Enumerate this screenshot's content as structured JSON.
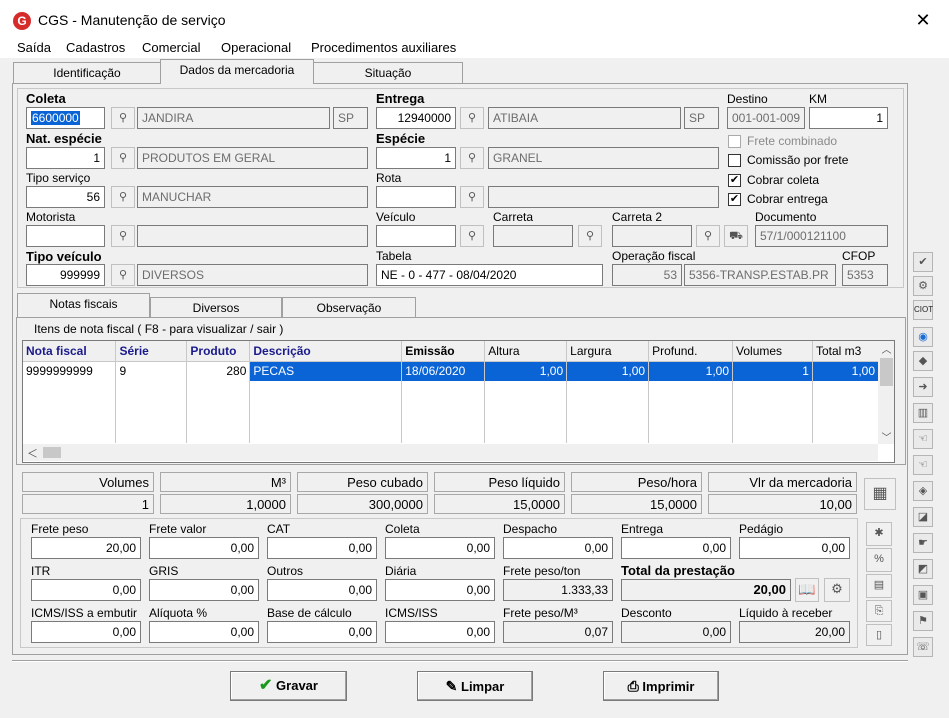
{
  "window": {
    "title": "CGS - Manutenção de serviço",
    "logo_letter": "G",
    "close_glyph": "✕"
  },
  "menu": [
    "Saída",
    "Cadastros",
    "Comercial",
    "Operacional",
    "Procedimentos auxiliares"
  ],
  "top_tabs": [
    "Identificação",
    "Dados da mercadoria",
    "Situação"
  ],
  "header": {
    "coleta": {
      "label": "Coleta",
      "code": "6600000",
      "city": "JANDIRA",
      "uf": "SP"
    },
    "entrega": {
      "label": "Entrega",
      "code": "12940000",
      "city": "ATIBAIA",
      "uf": "SP"
    },
    "destino": {
      "label": "Destino",
      "value": "001-001-009"
    },
    "km": {
      "label": "KM",
      "value": "1"
    },
    "nat_especie": {
      "label": "Nat. espécie",
      "code": "1",
      "desc": "PRODUTOS EM GERAL"
    },
    "especie": {
      "label": "Espécie",
      "code": "1",
      "desc": "GRANEL"
    },
    "tipo_servico": {
      "label": "Tipo serviço",
      "code": "56",
      "desc": "MANUCHAR"
    },
    "rota": {
      "label": "Rota",
      "code": "",
      "desc": ""
    },
    "motorista": {
      "label": "Motorista",
      "code": "",
      "desc": ""
    },
    "veiculo": {
      "label": "Veículo",
      "value": ""
    },
    "carreta": {
      "label": "Carreta",
      "value": ""
    },
    "carreta2": {
      "label": "Carreta 2",
      "value": ""
    },
    "documento": {
      "label": "Documento",
      "value": "57/1/000121100"
    },
    "tipo_veiculo": {
      "label": "Tipo veículo",
      "code": "999999",
      "desc": "DIVERSOS"
    },
    "tabela": {
      "label": "Tabela",
      "value": "NE - 0 - 477 - 08/04/2020"
    },
    "operacao_fiscal": {
      "label": "Operação fiscal",
      "code": "53",
      "desc": "5356-TRANSP.ESTAB.PR"
    },
    "cfop": {
      "label": "CFOP",
      "value": "5353"
    },
    "checks": [
      {
        "label": "Frete combinado",
        "checked": false,
        "disabled": true
      },
      {
        "label": "Comissão por frete",
        "checked": false,
        "disabled": false
      },
      {
        "label": "Cobrar coleta",
        "checked": true,
        "disabled": false
      },
      {
        "label": "Cobrar entrega",
        "checked": true,
        "disabled": false
      }
    ],
    "lookup_glyph": "⚲"
  },
  "inner_tabs": [
    "Notas fiscais",
    "Diversos",
    "Observação"
  ],
  "items_group": {
    "title": "Itens de nota fiscal ( F8 - para visualizar / sair )",
    "columns": [
      "Nota fiscal",
      "Série",
      "Produto",
      "Descrição",
      "Emissão",
      "Altura",
      "Largura",
      "Profund.",
      "Volumes",
      "Total m3"
    ],
    "rows": [
      [
        "9999999999",
        "9",
        "280",
        "PECAS",
        "18/06/2020",
        "1,00",
        "1,00",
        "1,00",
        "1",
        "1,00"
      ]
    ]
  },
  "totals": {
    "labels": [
      "Volumes",
      "M³",
      "Peso cubado",
      "Peso líquido",
      "Peso/hora",
      "Vlr da mercadoria"
    ],
    "values": [
      "1",
      "1,0000",
      "300,0000",
      "15,0000",
      "15,0000",
      "10,00"
    ]
  },
  "freight": {
    "row1": [
      {
        "label": "Frete peso",
        "value": "20,00"
      },
      {
        "label": "Frete valor",
        "value": "0,00"
      },
      {
        "label": "CAT",
        "value": "0,00"
      },
      {
        "label": "Coleta",
        "value": "0,00"
      },
      {
        "label": "Despacho",
        "value": "0,00"
      },
      {
        "label": "Entrega",
        "value": "0,00"
      },
      {
        "label": "Pedágio",
        "value": "0,00"
      }
    ],
    "row2": [
      {
        "label": "ITR",
        "value": "0,00"
      },
      {
        "label": "GRIS",
        "value": "0,00"
      },
      {
        "label": "Outros",
        "value": "0,00"
      },
      {
        "label": "Diária",
        "value": "0,00"
      },
      {
        "label": "Frete peso/ton",
        "value": "1.333,33"
      }
    ],
    "total": {
      "label": "Total da prestação",
      "value": "20,00"
    },
    "row3": [
      {
        "label": "ICMS/ISS a embutir",
        "value": "0,00"
      },
      {
        "label": "Alíquota %",
        "value": "0,00"
      },
      {
        "label": "Base de cálculo",
        "value": "0,00"
      },
      {
        "label": "ICMS/ISS",
        "value": "0,00"
      },
      {
        "label": "Frete peso/M³",
        "value": "0,07"
      },
      {
        "label": "Desconto",
        "value": "0,00"
      },
      {
        "label": "Líquido à receber",
        "value": "20,00"
      }
    ]
  },
  "buttons": {
    "gravar": "Gravar",
    "limpar": "Limpar",
    "imprimir": "Imprimir"
  },
  "side_toolbar_icons": [
    "check-icon",
    "settings-icon",
    "ciot-icon",
    "globe-icon",
    "tag-icon",
    "arrow-icon",
    "pages-icon",
    "hand-icon",
    "hand2-icon",
    "puzzle-icon",
    "fold-icon",
    "hand3-icon",
    "fold2-icon",
    "book-icon",
    "flag-icon",
    "speech-icon"
  ],
  "colors": {
    "selection": "#0a64d6",
    "header_text": "#1a1a8c",
    "logo_red": "#d62b2b"
  }
}
